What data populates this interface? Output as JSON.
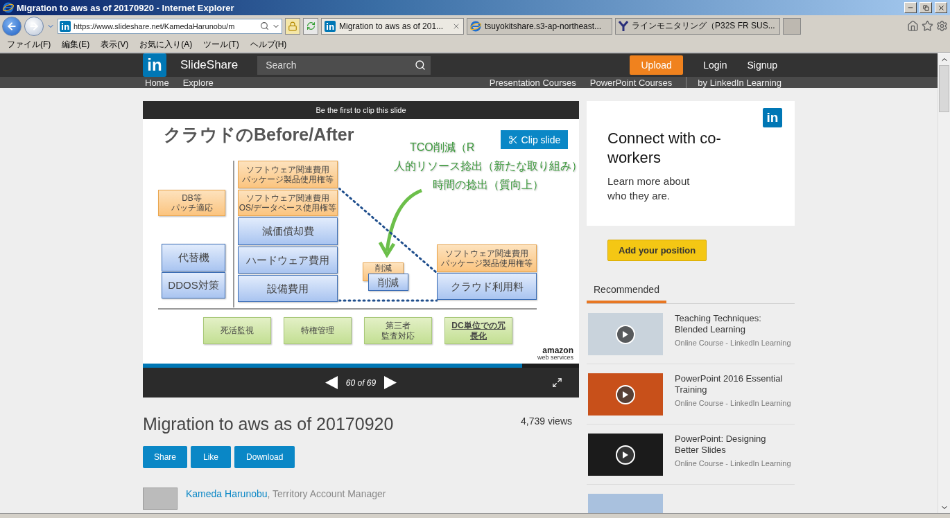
{
  "window": {
    "title": "Migration to aws as of 20170920 - Internet Explorer"
  },
  "address_bar": {
    "value": "https://www.slideshare.net/KamedaHarunobu/m"
  },
  "tabs": [
    {
      "label": "Migration to aws as of 201...",
      "selected": true,
      "kind": "linkedin"
    },
    {
      "label": "tsuyokitshare.s3-ap-northeast...",
      "selected": false,
      "kind": "ie"
    },
    {
      "label": "ラインモニタリング（P32S FR SUS...",
      "selected": false,
      "kind": "yahoo"
    }
  ],
  "menu": [
    "ファイル(F)",
    "編集(E)",
    "表示(V)",
    "お気に入り(A)",
    "ツール(T)",
    "ヘルプ(H)"
  ],
  "site_header": {
    "logo_mark": "in",
    "brand": "SlideShare",
    "search": {
      "placeholder": "Search"
    },
    "upload": "Upload",
    "login": "Login",
    "signup": "Signup"
  },
  "subnav": {
    "left": [
      "Home",
      "Explore"
    ],
    "right": [
      "Presentation Courses",
      "PowerPoint Courses"
    ],
    "partner": "by LinkedIn Learning"
  },
  "player": {
    "clip_banner": "Be the first to clip this slide",
    "clip_button": "Clip slide",
    "progress": {
      "level": 0.87
    },
    "page_counter": "60 of 69"
  },
  "slide": {
    "title": "クラウドのBefore/After",
    "callouts": [
      "TCO削減（R",
      "人的リソース捻出（新たな取り組み）",
      "時間の捻出（質向上）"
    ],
    "left_stack": [
      {
        "kind": "orange",
        "lines": [
          "DB等",
          "パッチ適応"
        ]
      },
      {
        "kind": "blue",
        "lines": [
          "代替機"
        ]
      },
      {
        "kind": "blue",
        "lines": [
          "DDOS対策"
        ]
      }
    ],
    "before_stack": [
      {
        "kind": "orange",
        "lines": [
          "ソフトウェア関連費用",
          "パッケージ製品使用権等"
        ]
      },
      {
        "kind": "orange",
        "lines": [
          "ソフトウェア関連費用",
          "OS/データベース使用権等"
        ]
      },
      {
        "kind": "blue",
        "lines": [
          "減価償却費"
        ]
      },
      {
        "kind": "blue",
        "lines": [
          "ハードウェア費用"
        ]
      },
      {
        "kind": "blue",
        "lines": [
          "設備費用"
        ]
      }
    ],
    "reduction": [
      {
        "kind": "orange",
        "lines": [
          "削減"
        ]
      },
      {
        "kind": "blue",
        "lines": [
          "削減"
        ]
      }
    ],
    "after_stack": [
      {
        "kind": "orange",
        "lines": [
          "ソフトウェア関連費用",
          "パッケージ製品使用権等"
        ]
      },
      {
        "kind": "blue",
        "lines": [
          "クラウド利用料"
        ]
      }
    ],
    "bottom_row": [
      {
        "kind": "green",
        "lines": [
          "死活監視"
        ],
        "emphasis": false
      },
      {
        "kind": "green",
        "lines": [
          "特権管理"
        ],
        "emphasis": false
      },
      {
        "kind": "green",
        "lines": [
          "第三者",
          "監査対応"
        ],
        "emphasis": false
      },
      {
        "kind": "green",
        "lines": [
          "DC単位での冗",
          "長化"
        ],
        "emphasis": true
      }
    ],
    "logo": {
      "name": "amazon",
      "tagline": "web services"
    }
  },
  "presentation": {
    "title": "Migration to aws as of 20170920",
    "views": "4,739 views",
    "actions": [
      "Share",
      "Like",
      "Download"
    ],
    "author": {
      "name": "Kameda Harunobu",
      "role": ", Territory Account Manager"
    }
  },
  "ad": {
    "logo_mark": "in",
    "heading": "Connect with co-workers",
    "body": "Learn more about who they are.",
    "cta": "Add your position"
  },
  "recommended": {
    "tab": "Recommended",
    "items": [
      {
        "title": "Teaching Techniques: Blended Learning",
        "subtitle": "Online Course - LinkedIn Learning"
      },
      {
        "title": "PowerPoint 2016 Essential Training",
        "subtitle": "Online Course - LinkedIn Learning"
      },
      {
        "title": "PowerPoint: Designing Better Slides",
        "subtitle": "Online Course - LinkedIn Learning"
      }
    ]
  }
}
